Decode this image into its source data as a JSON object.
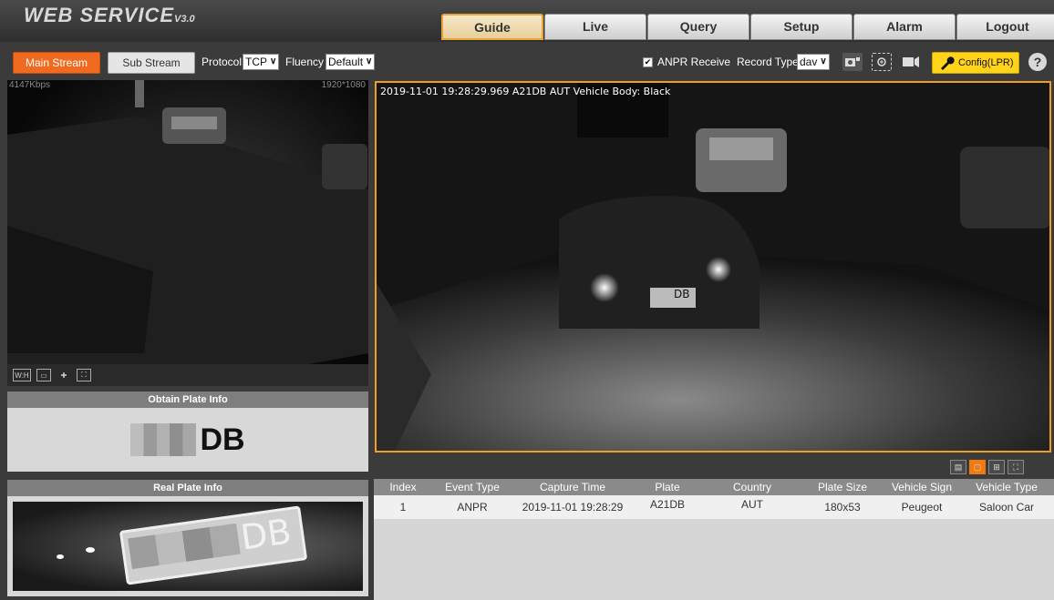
{
  "header": {
    "logo_text": "WEB SERVICE",
    "logo_version": "V3.0",
    "tabs": [
      {
        "label": "Guide",
        "active": true
      },
      {
        "label": "Live"
      },
      {
        "label": "Query"
      },
      {
        "label": "Setup"
      },
      {
        "label": "Alarm"
      },
      {
        "label": "Logout"
      }
    ]
  },
  "toolbar": {
    "main_stream": "Main Stream",
    "sub_stream": "Sub Stream",
    "protocol_label": "Protocol",
    "protocol_value": "TCP",
    "fluency_label": "Fluency",
    "fluency_value": "Default",
    "anpr_receive_label": "ANPR Receive",
    "anpr_checked": true,
    "record_type_label": "Record Type",
    "record_type_value": "dav",
    "config_label": "Config(LPR)",
    "help_label": "?"
  },
  "left_video": {
    "bitrate": "4147Kbps",
    "resolution": "1920*1080",
    "controls": [
      "W:H",
      "window",
      "ptz",
      "fullscreen"
    ]
  },
  "obtain_plate": {
    "title": "Obtain Plate Info",
    "plate_suffix": "DB"
  },
  "real_plate": {
    "title": "Real Plate Info",
    "plate_suffix": "DB"
  },
  "main_video": {
    "osd": "2019-11-01 19:28:29.969 A21DB AUT Vehicle Body: Black",
    "plate_overlay": "DB"
  },
  "layout_buttons": [
    "snapshot",
    "single",
    "quad",
    "fullscreen"
  ],
  "table": {
    "columns": [
      "Index",
      "Event Type",
      "Capture Time",
      "Plate",
      "Country",
      "Plate Size",
      "Vehicle Sign",
      "Vehicle Type"
    ],
    "rows": [
      [
        "1",
        "ANPR",
        "2019-11-01 19:28:29",
        "A21DB",
        "AUT",
        "180x53",
        "Peugeot",
        "Saloon Car"
      ]
    ]
  },
  "colors": {
    "accent_orange": "#f06b1f",
    "active_tab_border": "#e8a43a",
    "config_yellow": "#ffd31a"
  }
}
